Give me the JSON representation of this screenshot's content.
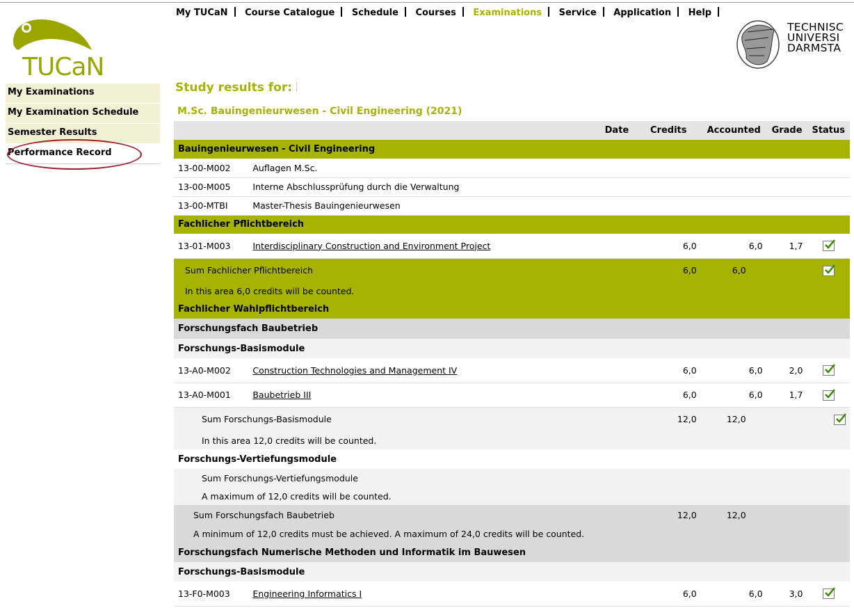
{
  "logo": {
    "text": "TUCaN"
  },
  "topnav": [
    {
      "label": "My TUCaN",
      "active": false
    },
    {
      "label": "Course Catalogue",
      "active": false
    },
    {
      "label": "Schedule",
      "active": false
    },
    {
      "label": "Courses",
      "active": false
    },
    {
      "label": "Examinations",
      "active": true
    },
    {
      "label": "Service",
      "active": false
    },
    {
      "label": "Application",
      "active": false
    },
    {
      "label": "Help",
      "active": false
    }
  ],
  "university": {
    "line1": "TECHNISC",
    "line2": "UNIVERSI",
    "line3": "DARMSTA"
  },
  "sidebar": {
    "items": [
      {
        "label": "My Examinations"
      },
      {
        "label": "My Examination Schedule"
      },
      {
        "label": "Semester Results"
      },
      {
        "label": "Performance Record"
      }
    ]
  },
  "main": {
    "title": "Study results for:",
    "program": "M.Sc. Bauingenieurwesen - Civil Engineering (2021)",
    "columns": {
      "date": "Date",
      "credits": "Credits",
      "accounted": "Accounted",
      "grade": "Grade",
      "status": "Status"
    }
  },
  "rows": {
    "r1": "Bauingenieurwesen - Civil Engineering",
    "r2": {
      "code": "13-00-M002",
      "name": "Auflagen M.Sc."
    },
    "r3": {
      "code": "13-00-M005",
      "name": "Interne Abschlussprüfung durch die Verwaltung"
    },
    "r4": {
      "code": "13-00-MTBI",
      "name": "Master-Thesis Bauingenieurwesen"
    },
    "r5": "Fachlicher Pflichtbereich",
    "r6": {
      "code": "13-01-M003",
      "name": "Interdisciplinary Construction and Environment Project",
      "credits": "6,0",
      "accounted": "6,0",
      "grade": "1,7"
    },
    "r7": {
      "name": "Sum Fachlicher Pflichtbereich",
      "credits": "6,0",
      "accounted": "6,0"
    },
    "r8": "In this area 6,0 credits will be counted.",
    "r9": "Fachlicher Wahlpflichtbereich",
    "r10": "Forschungsfach Baubetrieb",
    "r11": "Forschungs-Basismodule",
    "r12": {
      "code": "13-A0-M002",
      "name": "Construction Technologies and Management IV",
      "credits": "6,0",
      "accounted": "6,0",
      "grade": "2,0"
    },
    "r13": {
      "code": "13-A0-M001",
      "name": "Baubetrieb III",
      "credits": "6,0",
      "accounted": "6,0",
      "grade": "1,7"
    },
    "r14": {
      "name": "Sum Forschungs-Basismodule",
      "credits": "12,0",
      "accounted": "12,0"
    },
    "r15": "In this area 12,0 credits will be counted.",
    "r16": "Forschungs-Vertiefungsmodule",
    "r17": "Sum Forschungs-Vertiefungsmodule",
    "r18": "A maximum of 12,0 credits will be counted.",
    "r19": {
      "name": "Sum Forschungsfach Baubetrieb",
      "credits": "12,0",
      "accounted": "12,0"
    },
    "r20": "A minimum of 12,0 credits must be achieved. A maximum of 24,0 credits will be counted.",
    "r21": "Forschungsfach Numerische Methoden und Informatik im Bauwesen",
    "r22": "Forschungs-Basismodule",
    "r23": {
      "code": "13-F0-M003",
      "name": "Engineering Informatics I",
      "credits": "6,0",
      "accounted": "6,0",
      "grade": "3,0"
    }
  },
  "colors": {
    "accent": "#a6b300",
    "sidebar_bg": "#f1f1d3",
    "annotation_circle": "#9a1f2a"
  }
}
